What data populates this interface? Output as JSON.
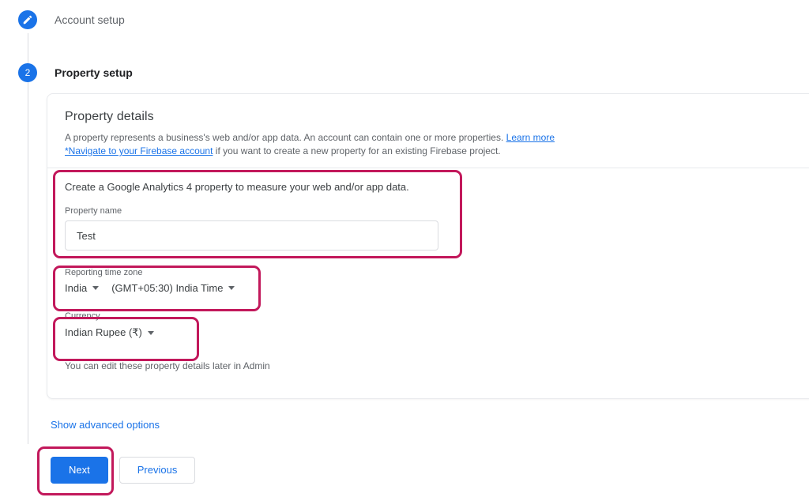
{
  "stepper": {
    "step1": {
      "label": "Account setup",
      "icon": "pencil-icon",
      "state": "completed"
    },
    "step2": {
      "number": "2",
      "label": "Property setup",
      "state": "active"
    }
  },
  "card": {
    "title": "Property details",
    "description_part1": "A property represents a business's web and/or app data. An account can contain one or more properties. ",
    "learn_more_link": "Learn more",
    "firebase_link": "*Navigate to your Firebase account",
    "description_part2": " if you want to create a new property for an existing Firebase project.",
    "lead_text": "Create a Google Analytics 4 property to measure your web and/or app data.",
    "property_name_label": "Property name",
    "property_name_value": "Test",
    "property_name_placeholder": "Property name",
    "timezone_label": "Reporting time zone",
    "timezone_country": "India",
    "timezone_offset": "(GMT+05:30) India Time",
    "currency_label": "Currency",
    "currency_value": "Indian Rupee (₹)",
    "hint": "You can edit these property details later in Admin"
  },
  "actions": {
    "advanced_options": "Show advanced options",
    "next": "Next",
    "previous": "Previous"
  },
  "colors": {
    "accent_blue": "#1a73e8",
    "annotation_red": "#c2185b",
    "text_primary": "#3c4043",
    "text_secondary": "#5f6368"
  }
}
